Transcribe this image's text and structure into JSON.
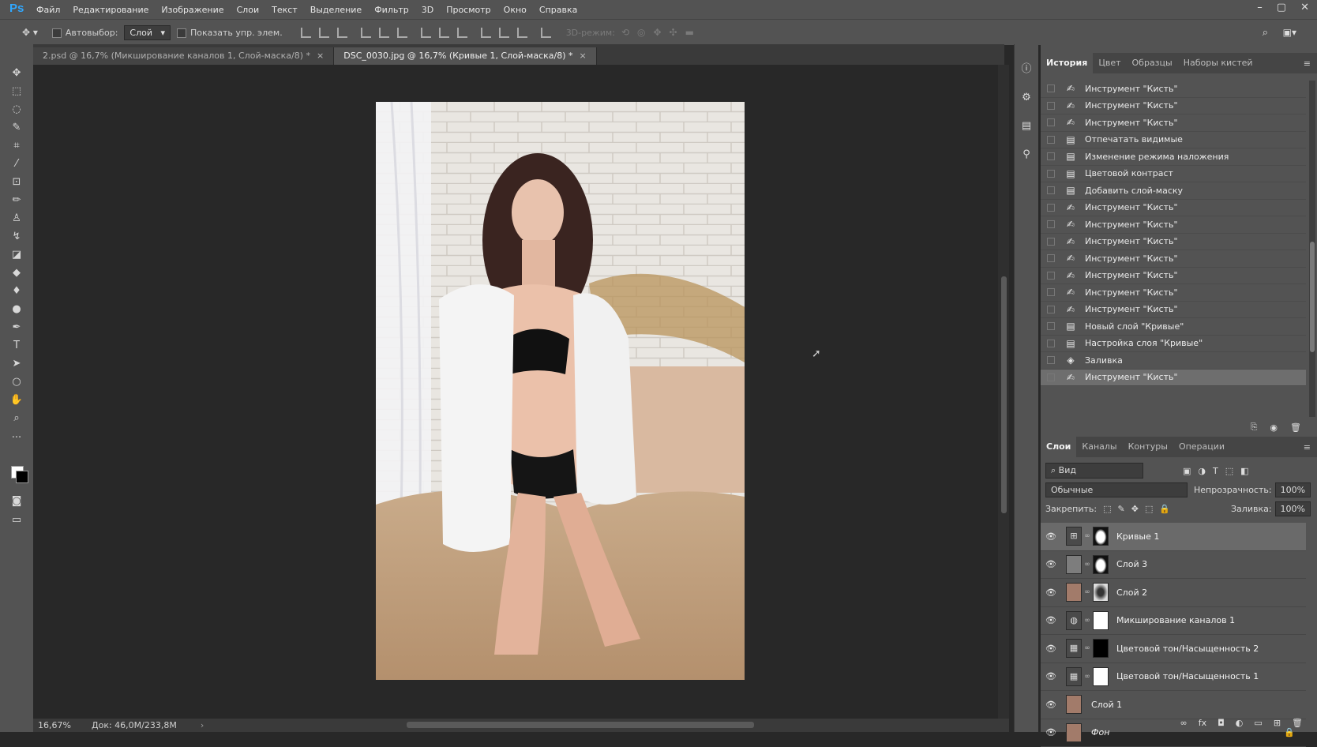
{
  "app": {
    "logo": "Ps"
  },
  "menu": [
    "Файл",
    "Редактирование",
    "Изображение",
    "Слои",
    "Текст",
    "Выделение",
    "Фильтр",
    "3D",
    "Просмотр",
    "Окно",
    "Справка"
  ],
  "window_controls": [
    "–",
    "▢",
    "✕"
  ],
  "options": {
    "autoselect_label": "Автовыбор:",
    "autoselect_value": "Слой",
    "show_controls_label": "Показать упр. элем.",
    "mode_3d_label": "3D-режим:"
  },
  "tabs": [
    {
      "label": "2.psd @ 16,7% (Микширование каналов 1, Слой-маска/8) *",
      "active": false
    },
    {
      "label": "DSC_0030.jpg @ 16,7% (Кривые 1, Слой-маска/8) *",
      "active": true
    }
  ],
  "status": {
    "zoom": "16,67%",
    "doc": "Док: 46,0M/233,8M"
  },
  "history_panel": {
    "tabs": [
      "История",
      "Цвет",
      "Образцы",
      "Наборы кистей"
    ],
    "items": [
      {
        "icon": "brush-icon",
        "label": "Инструмент \"Кисть\""
      },
      {
        "icon": "brush-icon",
        "label": "Инструмент \"Кисть\""
      },
      {
        "icon": "brush-icon",
        "label": "Инструмент \"Кисть\""
      },
      {
        "icon": "document-icon",
        "label": "Отпечатать видимые"
      },
      {
        "icon": "document-icon",
        "label": "Изменение режима наложения"
      },
      {
        "icon": "document-icon",
        "label": "Цветовой контраст"
      },
      {
        "icon": "document-icon",
        "label": "Добавить слой-маску"
      },
      {
        "icon": "brush-icon",
        "label": "Инструмент \"Кисть\""
      },
      {
        "icon": "brush-icon",
        "label": "Инструмент \"Кисть\""
      },
      {
        "icon": "brush-icon",
        "label": "Инструмент \"Кисть\""
      },
      {
        "icon": "brush-icon",
        "label": "Инструмент \"Кисть\""
      },
      {
        "icon": "brush-icon",
        "label": "Инструмент \"Кисть\""
      },
      {
        "icon": "brush-icon",
        "label": "Инструмент \"Кисть\""
      },
      {
        "icon": "brush-icon",
        "label": "Инструмент \"Кисть\""
      },
      {
        "icon": "document-icon",
        "label": "Новый слой \"Кривые\""
      },
      {
        "icon": "document-icon",
        "label": "Настройка слоя \"Кривые\""
      },
      {
        "icon": "bucket-icon",
        "label": "Заливка"
      },
      {
        "icon": "brush-icon",
        "label": "Инструмент \"Кисть\""
      }
    ]
  },
  "layers_panel": {
    "tabs": [
      "Слои",
      "Каналы",
      "Контуры",
      "Операции"
    ],
    "filter_label": "Вид",
    "blend_mode": "Обычные",
    "opacity_label": "Непрозрачность:",
    "opacity_value": "100%",
    "lock_label": "Закрепить:",
    "fill_label": "Заливка:",
    "fill_value": "100%",
    "layers": [
      {
        "name": "Кривые 1",
        "kind": "curves-adjustment",
        "mask": "white-shape",
        "selected": true
      },
      {
        "name": "Слой 3",
        "kind": "gray",
        "mask": "white-shape",
        "selected": false
      },
      {
        "name": "Слой 2",
        "kind": "photo",
        "mask": "dark-shape",
        "selected": false
      },
      {
        "name": "Микширование каналов 1",
        "kind": "channel-mixer-adjustment",
        "mask": "white",
        "selected": false
      },
      {
        "name": "Цветовой тон/Насыщенность 2",
        "kind": "hue-saturation-adjustment",
        "mask": "black",
        "selected": false
      },
      {
        "name": "Цветовой тон/Насыщенность 1",
        "kind": "hue-saturation-adjustment",
        "mask": "white",
        "selected": false
      },
      {
        "name": "Слой 1",
        "kind": "photo",
        "mask": "",
        "selected": false
      },
      {
        "name": "Фон",
        "kind": "photo",
        "mask": "",
        "selected": false,
        "locked": true
      }
    ]
  }
}
